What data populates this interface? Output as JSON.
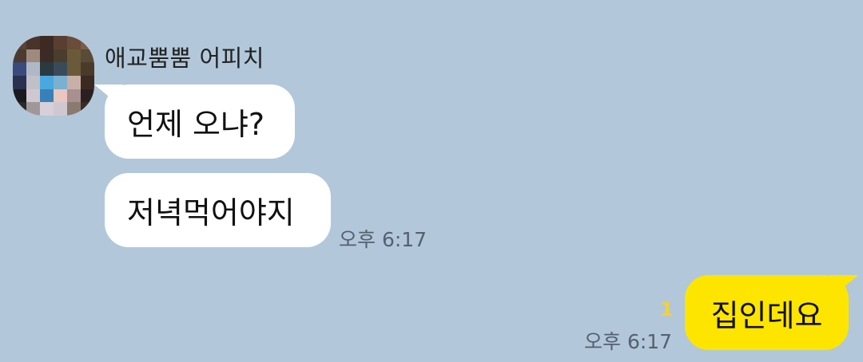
{
  "conversation": {
    "sender_name": "애교뿜뿜 어피치",
    "avatar_pixels": [
      "#5a4238",
      "#4a3329",
      "#3e2a24",
      "#5a3f30",
      "#6a4c3a",
      "#7a5d48",
      "#4a3a30",
      "#9f8a7f",
      "#3b2b24",
      "#4a3d2c",
      "#6a5a3a",
      "#5a4a38",
      "#3a4a7a",
      "#b0b8c8",
      "#2a3a40",
      "#3a4a5a",
      "#6a5a3a",
      "#4a3a2a",
      "#2a3050",
      "#c0c0c8",
      "#4aa8e0",
      "#7ab0d0",
      "#c8b0a8",
      "#3a2a20",
      "#1a1a20",
      "#d0c8d0",
      "#3a80b8",
      "#e8c8c0",
      "#a89090",
      "#2a2020",
      "#2a2a2a",
      "#a09898",
      "#d8d0d8",
      "#d0c8d0",
      "#8a7a70",
      "#3a2a28"
    ],
    "messages": [
      {
        "text": "언제 오냐?"
      },
      {
        "text": "저녁먹어야지",
        "time": "오후 6:17"
      }
    ],
    "my_message": {
      "text": "집인데요",
      "time": "오후 6:17",
      "unread_count": "1"
    }
  },
  "colors": {
    "background": "#B2C7DA",
    "incoming_bubble": "#FFFFFF",
    "outgoing_bubble": "#FEE500",
    "unread_count": "#F2D03B"
  }
}
